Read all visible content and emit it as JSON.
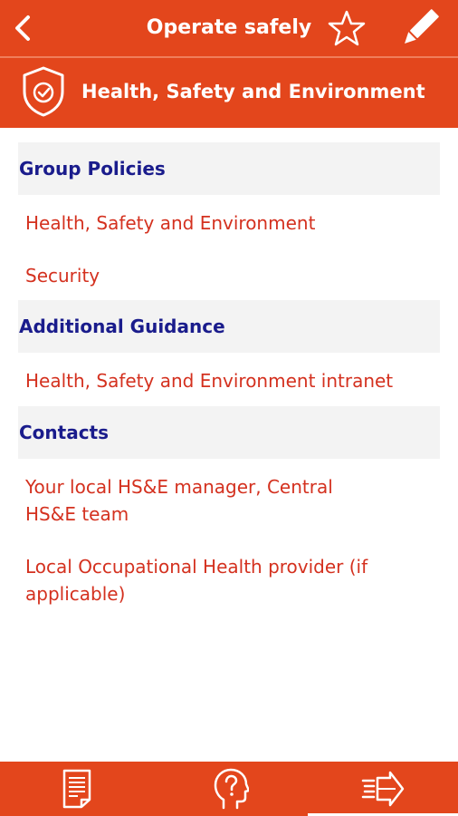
{
  "header": {
    "title": "Operate safely",
    "back_icon": "chevron-left-icon",
    "favorite_icon": "star-icon",
    "edit_icon": "pencil-icon"
  },
  "section": {
    "title": "Health, Safety and Environment",
    "icon": "shield-check-icon"
  },
  "groups": [
    {
      "title": "Group Policies",
      "links": [
        "Health, Safety and Environment",
        "Security"
      ]
    },
    {
      "title": "Additional Guidance",
      "links": [
        "Health, Safety and Environment intranet"
      ]
    },
    {
      "title": "Contacts",
      "links": [
        "Your local HS&E manager, Central HS&E team",
        "Local Occupational Health provider (if applicable)"
      ]
    }
  ],
  "bottom_nav": {
    "tabs": [
      "document-icon",
      "help-head-icon",
      "forward-arrows-icon"
    ],
    "active": "forward-arrows-icon"
  },
  "colors": {
    "brand": "#e3461c",
    "heading": "#1a1c8c",
    "link": "#d4311f",
    "header_bg": "#f3f3f3"
  }
}
